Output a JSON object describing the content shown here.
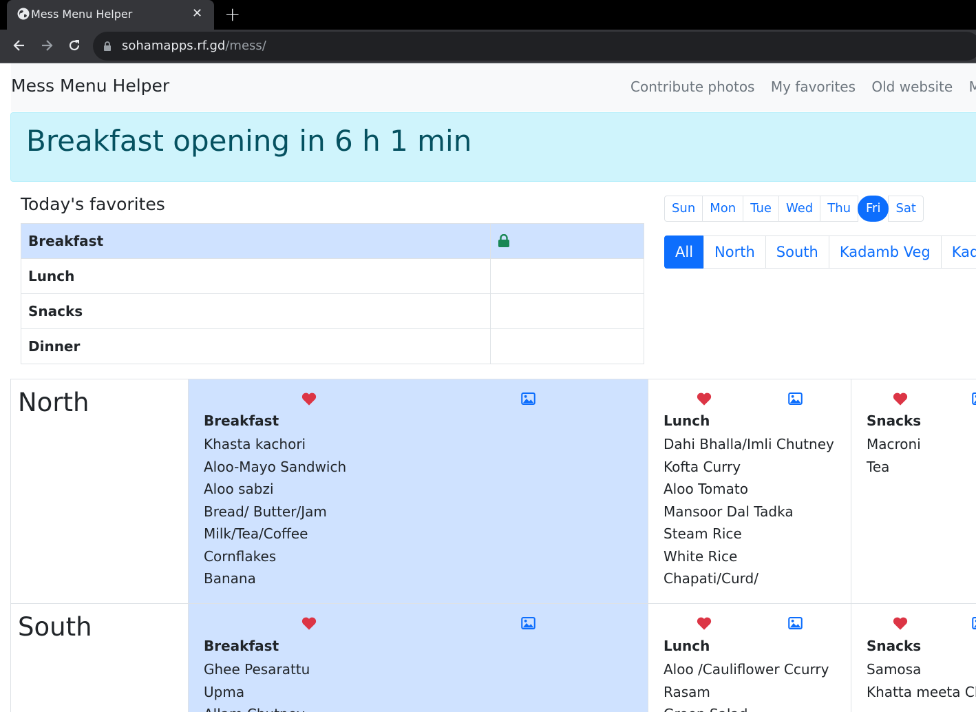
{
  "browser": {
    "tab_title": "Mess Menu Helper",
    "url_domain": "sohamapps.rf.gd",
    "url_path": "/mess/",
    "close_glyph": "✕",
    "newtab_glyph": "+"
  },
  "navbar": {
    "brand": "Mess Menu Helper",
    "links": [
      "Contribute photos",
      "My favorites",
      "Old website",
      "Mess"
    ]
  },
  "alert": {
    "text": "Breakfast opening in 6 h 1 min"
  },
  "favorites": {
    "title": "Today's favorites",
    "rows": [
      {
        "meal": "Breakfast",
        "locked": true
      },
      {
        "meal": "Lunch"
      },
      {
        "meal": "Snacks"
      },
      {
        "meal": "Dinner"
      }
    ]
  },
  "days": [
    "Sun",
    "Mon",
    "Tue",
    "Wed",
    "Thu",
    "Fri",
    "Sat"
  ],
  "selected_day": "Fri",
  "messes": [
    "All",
    "North",
    "South",
    "Kadamb Veg",
    "Kadam"
  ],
  "selected_mess": "All",
  "menu": [
    {
      "mess": "North",
      "breakfast": {
        "title": "Breakfast",
        "items": [
          "Khasta kachori",
          "Aloo-Mayo Sandwich",
          "Aloo sabzi",
          "Bread/ Butter/Jam",
          "Milk/Tea/Coffee",
          "Cornflakes",
          "Banana"
        ]
      },
      "lunch": {
        "title": "Lunch",
        "items": [
          "Dahi Bhalla/Imli Chutney",
          "Kofta Curry",
          "Aloo Tomato",
          "Mansoor Dal Tadka",
          "Steam Rice",
          "White Rice",
          "Chapati/Curd/"
        ]
      },
      "snacks": {
        "title": "Snacks",
        "items": [
          "Macroni",
          "Tea"
        ]
      }
    },
    {
      "mess": "South",
      "breakfast": {
        "title": "Breakfast",
        "items": [
          "Ghee Pesarattu",
          "Upma",
          "Allam Chutney"
        ]
      },
      "lunch": {
        "title": "Lunch",
        "items": [
          "Aloo /Cauliflower Ccurry",
          "Rasam",
          "Green Salad"
        ]
      },
      "snacks": {
        "title": "Snacks",
        "items": [
          "Samosa",
          "Khatta meeta Chutney"
        ]
      }
    }
  ],
  "colors": {
    "primary": "#0d6efd",
    "heart": "#dc3545",
    "lock": "#198754",
    "active_bg": "#cfe2ff",
    "alert_bg": "#cff4fc",
    "alert_text": "#055160"
  }
}
